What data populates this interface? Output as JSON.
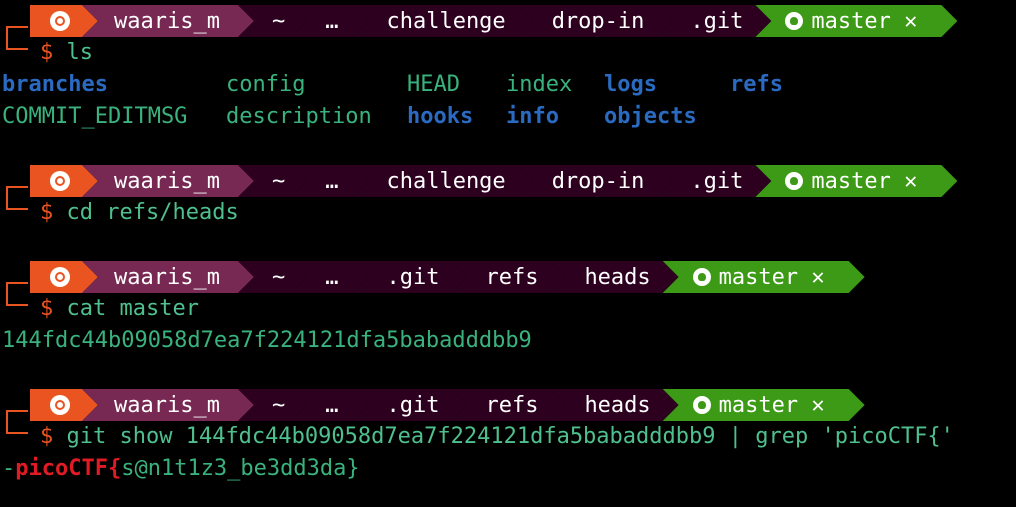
{
  "prompts": [
    {
      "user": "waaris_m",
      "path": [
        "~",
        "…",
        "challenge",
        "drop-in",
        ".git"
      ],
      "branch": "master",
      "branch_status": "✕",
      "command": "ls"
    },
    {
      "user": "waaris_m",
      "path": [
        "~",
        "…",
        "challenge",
        "drop-in",
        ".git"
      ],
      "branch": "master",
      "branch_status": "✕",
      "command": "cd refs/heads"
    },
    {
      "user": "waaris_m",
      "path": [
        "~",
        "…",
        ".git",
        "refs",
        "heads"
      ],
      "branch": "master",
      "branch_status": "✕",
      "command": "cat master"
    },
    {
      "user": "waaris_m",
      "path": [
        "~",
        "…",
        ".git",
        "refs",
        "heads"
      ],
      "branch": "master",
      "branch_status": "✕",
      "command": "git show 144fdc44b09058d7ea7f224121dfa5babadddbb9 | grep 'picoCTF{'"
    }
  ],
  "prompt_symbol": "$",
  "ls_output": {
    "row1": [
      "branches",
      "config",
      "HEAD",
      "index",
      "logs",
      "refs"
    ],
    "row2": [
      "COMMIT_EDITMSG",
      "description",
      "hooks",
      "info",
      "objects"
    ]
  },
  "cat_output": "144fdc44b09058d7ea7f224121dfa5babadddbb9",
  "grep_output": {
    "prefix": "-",
    "match": "picoCTF{",
    "rest": "s@n1t1z3_be3dd3da}"
  },
  "colors": {
    "os_segment": "#e95420",
    "user_segment": "#772953",
    "path_segment": "#2c001e",
    "git_segment": "#3c9a16",
    "directory": "#2a6bc1",
    "file": "#3ab27d",
    "match": "#e01b24"
  },
  "icons": [
    "ubuntu-icon",
    "github-icon"
  ]
}
